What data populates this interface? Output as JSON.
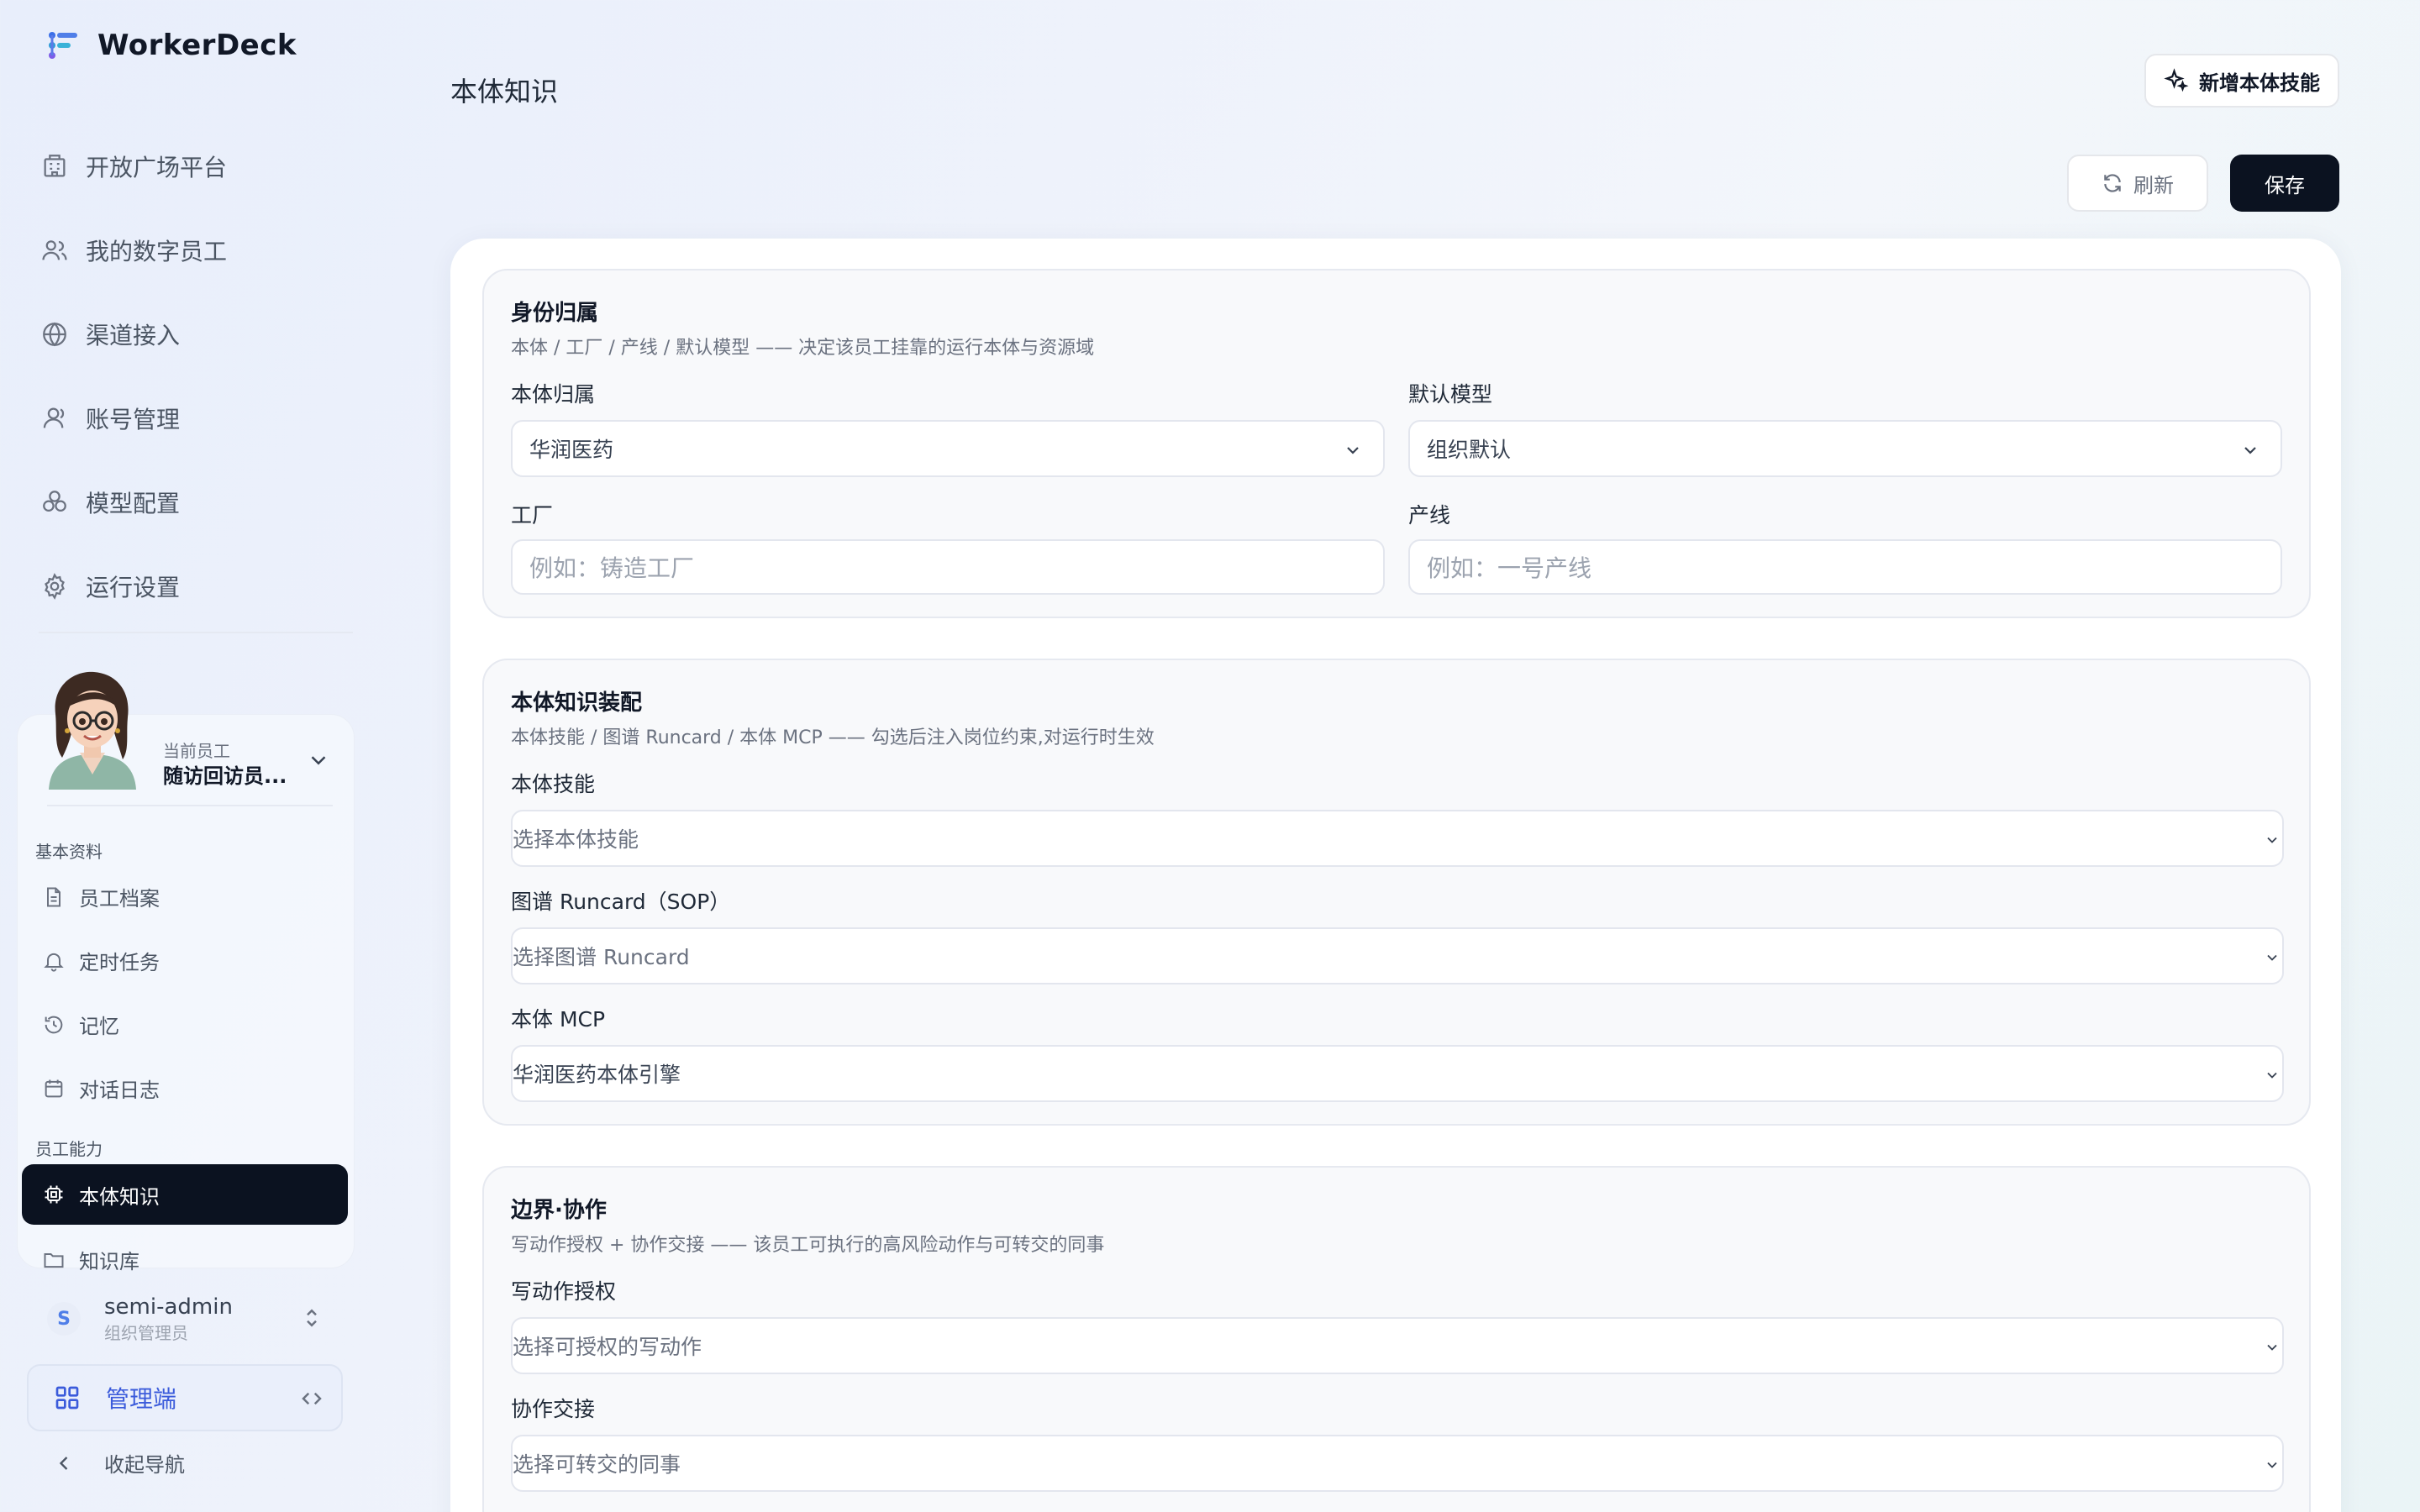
{
  "brand": {
    "name": "WorkerDeck"
  },
  "main_nav": [
    {
      "label": "开放广场平台",
      "icon": "building-icon"
    },
    {
      "label": "我的数字员工",
      "icon": "users-icon"
    },
    {
      "label": "渠道接入",
      "icon": "globe-icon"
    },
    {
      "label": "账号管理",
      "icon": "user-icon"
    },
    {
      "label": "模型配置",
      "icon": "cubes-icon"
    },
    {
      "label": "运行设置",
      "icon": "gear-icon"
    }
  ],
  "employee": {
    "label": "当前员工",
    "name": "随访回访员..."
  },
  "sections_nav": {
    "basic_label": "基本资料",
    "basic_items": [
      {
        "label": "员工档案",
        "icon": "document-icon"
      },
      {
        "label": "定时任务",
        "icon": "bell-icon"
      },
      {
        "label": "记忆",
        "icon": "history-icon"
      },
      {
        "label": "对话日志",
        "icon": "calendar-icon"
      }
    ],
    "ability_label": "员工能力",
    "ability_items": [
      {
        "label": "本体知识",
        "icon": "chip-icon",
        "active": true
      },
      {
        "label": "知识库",
        "icon": "folder-icon"
      }
    ]
  },
  "user": {
    "initial": "S",
    "name": "semi-admin",
    "role": "组织管理员"
  },
  "admin": {
    "label": "管理端"
  },
  "collapse": {
    "label": "收起导航"
  },
  "page": {
    "title": "本体知识",
    "new_button": "新增本体技能",
    "refresh_button": "刷新",
    "save_button": "保存"
  },
  "identity": {
    "title": "身份归属",
    "desc": "本体 / 工厂 / 产线 / 默认模型 —— 决定该员工挂靠的运行本体与资源域",
    "ontology_label": "本体归属",
    "ontology_value": "华润医药",
    "model_label": "默认模型",
    "model_value": "组织默认",
    "factory_label": "工厂",
    "factory_placeholder": "例如：铸造工厂",
    "line_label": "产线",
    "line_placeholder": "例如：一号产线"
  },
  "knowledge": {
    "title": "本体知识装配",
    "desc": "本体技能 / 图谱 Runcard / 本体 MCP —— 勾选后注入岗位约束,对运行时生效",
    "skills_label": "本体技能",
    "skills_placeholder": "选择本体技能",
    "runcard_label": "图谱 Runcard（SOP）",
    "runcard_placeholder": "选择图谱 Runcard",
    "mcp_label": "本体 MCP",
    "mcp_value": "华润医药本体引擎"
  },
  "boundary": {
    "title": "边界·协作",
    "desc": "写动作授权 + 协作交接 —— 该员工可执行的高风险动作与可转交的同事",
    "write_label": "写动作授权",
    "write_placeholder": "选择可授权的写动作",
    "handoff_label": "协作交接",
    "handoff_placeholder": "选择可转交的同事"
  }
}
